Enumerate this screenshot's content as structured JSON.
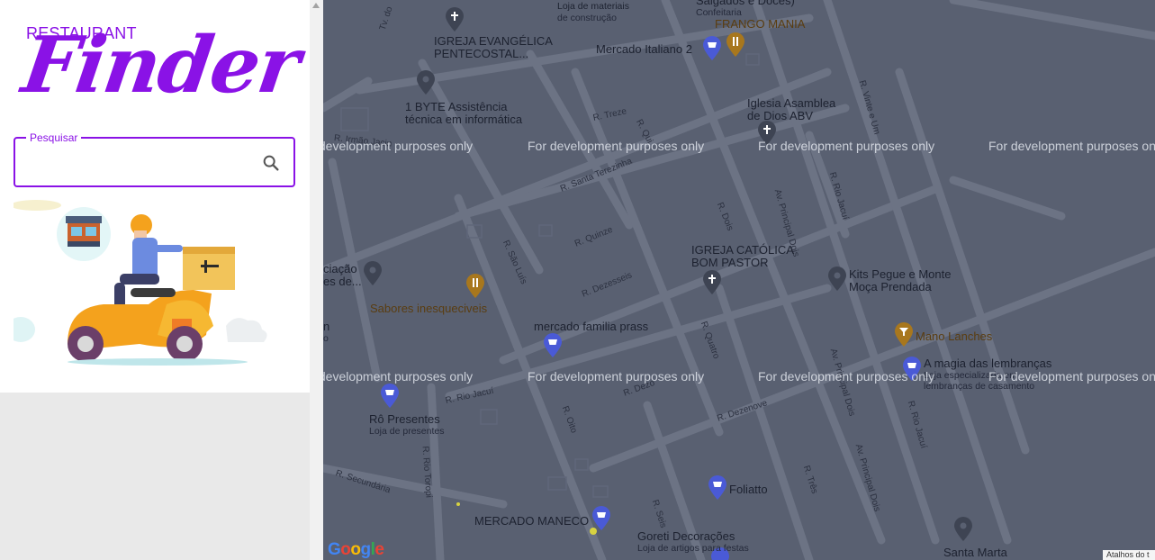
{
  "sidebar": {
    "logo_top": "RESTAURANT",
    "logo_script": "Finder",
    "search": {
      "label": "Pesquisar",
      "value": "",
      "placeholder": ""
    },
    "colors": {
      "accent": "#8a12e6"
    }
  },
  "map": {
    "watermark": "For development purposes only",
    "google": "Google",
    "shortcuts": "Atalhos do t",
    "streets": {
      "tv": "Tv. do",
      "irmao": "R. Irmão Jacin",
      "treze": "R. Treze",
      "quinze_a": "R. Qui",
      "santa_terezinha": "R. Santa Terezinha",
      "quinze": "R. Quinze",
      "sao_luis": "R. São Luís",
      "dezesseis": "R. Dezesseis",
      "dois": "R. Dois",
      "principal_dois": "Av. Principal Dois",
      "rio_jacui": "R. Rio Jacuí",
      "vinte_e_um": "R. Vinte e Um",
      "quatro": "R. Quatro",
      "dezoito": "R. Dezo",
      "rio_jacui_2": "R. Rio Jacuí",
      "oito": "R. Oito",
      "dezenove": "R. Dezenove",
      "principal_dois_2": "Av. Principal Dois",
      "rio_jacui_3": "R. Rio Jacuí",
      "rio_toropi": "R. Rio Toropi",
      "secundaria": "R. Secundária",
      "seis": "R. Seis",
      "tres": "R. Três",
      "principal_dois_3": "Av. Principal Dois"
    },
    "places": {
      "materiais": "Loja de materiais",
      "construcao": "de construção",
      "salgados": "Salgados e Doces)",
      "confeitaria": "Confeitaria",
      "frango_mania": "FRANGO MANIA",
      "igreja_evangelica": "IGREJA EVANGÉLICA",
      "pentecostal": "PENTECOSTAL...",
      "mercado_italiano": "Mercado Italiano 2",
      "byte": "1 BYTE Assistência",
      "byte_sub": "técnica em informática",
      "iglesia": "Iglesia Asamblea",
      "iglesia_sub": "de Dios ABV",
      "igreja_catolica": "IGREJA CATÓLICA",
      "bom_pastor": "BOM PASTOR",
      "kits": "Kits Pegue e Monte",
      "moca": "Moça Prendada",
      "associacao": "ciação",
      "associacao_sub": "es de...",
      "sabores": "Sabores inesqueciveis",
      "mercado_familia": "mercado familia prass",
      "mano_lanches": "Mano Lanches",
      "magia": "A magia das lembranças",
      "magia_sub1": "Loja especializada em",
      "magia_sub2": "lembranças de casamento",
      "n": "n",
      "o": "o",
      "ro_presentes": "Rô Presentes",
      "loja_presentes": "Loja de presentes",
      "foliatto": "Foliatto",
      "mercado_maneco": "MERCADO MANECO",
      "goreti": "Goreti Decorações",
      "goreti_sub": "Loja de artigos para festas",
      "santa_marta": "Santa Marta"
    }
  }
}
